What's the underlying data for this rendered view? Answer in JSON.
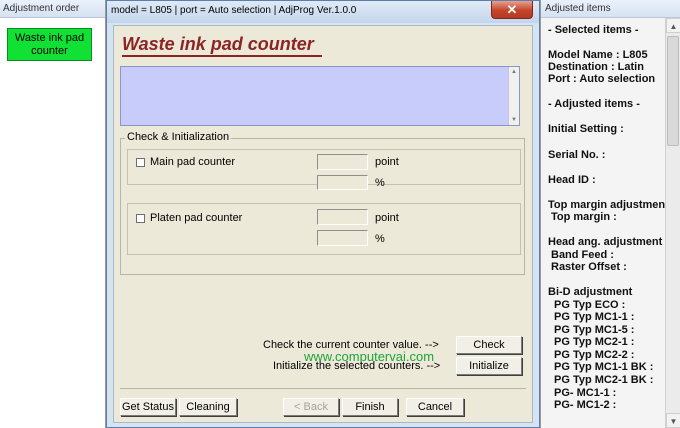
{
  "left_panel": {
    "title": "Adjustment order",
    "items": [
      {
        "label_line1": "Waste ink pad",
        "label_line2": "counter"
      }
    ]
  },
  "dialog": {
    "window_title": "model = L805 | port = Auto selection | AdjProg Ver.1.0.0",
    "close_label": "✕",
    "heading": "Waste ink pad counter",
    "group_title": "Check & Initialization",
    "counters": [
      {
        "label": "Main pad counter",
        "unit_point": "point",
        "unit_percent": "%"
      },
      {
        "label": "Platen pad counter",
        "unit_point": "point",
        "unit_percent": "%"
      }
    ],
    "check_text": "Check the current counter value. -->",
    "init_text": "Initialize the selected counters. -->",
    "check_button": "Check",
    "initialize_button": "Initialize",
    "watermark": "www.computervai.com",
    "footer": {
      "get_status": "Get Status",
      "cleaning": "Cleaning",
      "back": "< Back",
      "finish": "Finish",
      "cancel": "Cancel"
    }
  },
  "right_panel": {
    "title": "Adjusted items",
    "lines": [
      "- Selected items -",
      "Model Name : L805",
      "Destination : Latin",
      "Port : Auto selection",
      "- Adjusted items -",
      "Initial Setting :",
      "Serial No. :",
      "Head ID :",
      "Top margin adjustment",
      " Top margin :",
      "Head ang. adjustment",
      " Band Feed :",
      " Raster Offset :",
      "Bi-D adjustment",
      " PG Typ ECO :",
      " PG Typ MC1-1 :",
      " PG Typ MC1-5 :",
      " PG Typ MC2-1 :",
      " PG Typ MC2-2 :",
      " PG Typ MC1-1 BK :",
      " PG Typ MC2-1 BK :",
      " PG- MC1-1 :",
      " PG- MC1-2 :"
    ]
  }
}
